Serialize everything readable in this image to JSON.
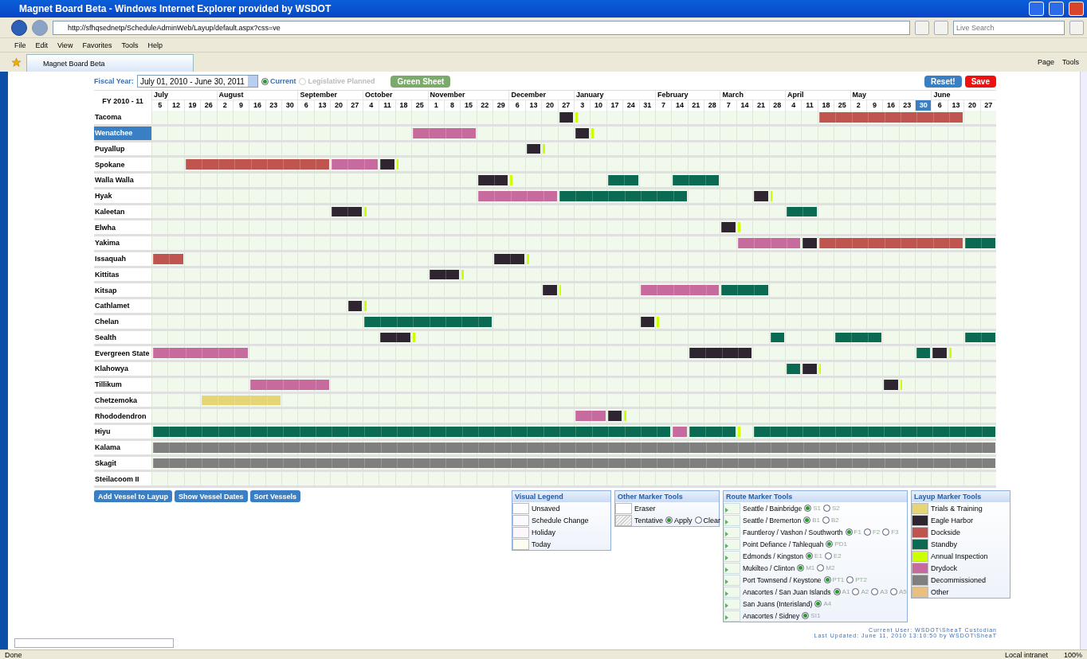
{
  "window": {
    "title": "Magnet Board Beta - Windows Internet Explorer provided by WSDOT"
  },
  "address_bar": {
    "url": "http://sfhqsednetp/ScheduleAdminWeb/Layup/default.aspx?css=ve"
  },
  "search": {
    "placeholder": "Live Search"
  },
  "menu": [
    "File",
    "Edit",
    "View",
    "Favorites",
    "Tools",
    "Help"
  ],
  "tabs": [
    {
      "label": "Magnet Board Beta",
      "selected": true
    }
  ],
  "command_bar": [
    "Page",
    "Tools"
  ],
  "fiscal_year": {
    "label": "Fiscal Year:",
    "value": "July 01, 2010 - June 30, 2011",
    "options": [
      {
        "label": "Current",
        "selected": true,
        "disabled": false
      },
      {
        "label": "Legislative Planned",
        "selected": false,
        "disabled": true
      }
    ],
    "green_sheet": "Green Sheet"
  },
  "actions": [
    "Reset!",
    "Save"
  ],
  "grid": {
    "corner": "FY 2010 - 11",
    "months": [
      {
        "label": "July",
        "days": [
          {
            "label": "5",
            "selected": false
          },
          {
            "label": "12",
            "selected": false
          },
          {
            "label": "19",
            "selected": false
          },
          {
            "label": "26",
            "selected": false
          }
        ]
      },
      {
        "label": "August",
        "days": [
          {
            "label": "2",
            "selected": false
          },
          {
            "label": "9",
            "selected": false
          },
          {
            "label": "16",
            "selected": false
          },
          {
            "label": "23",
            "selected": false
          },
          {
            "label": "30",
            "selected": false
          }
        ]
      },
      {
        "label": "September",
        "days": [
          {
            "label": "6",
            "selected": false
          },
          {
            "label": "13",
            "selected": false
          },
          {
            "label": "20",
            "selected": false
          },
          {
            "label": "27",
            "selected": false
          }
        ]
      },
      {
        "label": "October",
        "days": [
          {
            "label": "4",
            "selected": false
          },
          {
            "label": "11",
            "selected": false
          },
          {
            "label": "18",
            "selected": false
          },
          {
            "label": "25",
            "selected": false
          }
        ]
      },
      {
        "label": "November",
        "days": [
          {
            "label": "1",
            "selected": false
          },
          {
            "label": "8",
            "selected": false
          },
          {
            "label": "15",
            "selected": false
          },
          {
            "label": "22",
            "selected": false
          },
          {
            "label": "29",
            "selected": false
          }
        ]
      },
      {
        "label": "December",
        "days": [
          {
            "label": "6",
            "selected": false
          },
          {
            "label": "13",
            "selected": false
          },
          {
            "label": "20",
            "selected": false
          },
          {
            "label": "27",
            "selected": false
          }
        ]
      },
      {
        "label": "January",
        "days": [
          {
            "label": "3",
            "selected": false
          },
          {
            "label": "10",
            "selected": false
          },
          {
            "label": "17",
            "selected": false
          },
          {
            "label": "24",
            "selected": false
          },
          {
            "label": "31",
            "selected": false
          }
        ]
      },
      {
        "label": "February",
        "days": [
          {
            "label": "7",
            "selected": false
          },
          {
            "label": "14",
            "selected": false
          },
          {
            "label": "21",
            "selected": false
          },
          {
            "label": "28",
            "selected": false
          }
        ]
      },
      {
        "label": "March",
        "days": [
          {
            "label": "7",
            "selected": false
          },
          {
            "label": "14",
            "selected": false
          },
          {
            "label": "21",
            "selected": false
          },
          {
            "label": "28",
            "selected": false
          }
        ]
      },
      {
        "label": "April",
        "days": [
          {
            "label": "4",
            "selected": false
          },
          {
            "label": "11",
            "selected": false
          },
          {
            "label": "18",
            "selected": false
          },
          {
            "label": "25",
            "selected": false
          }
        ]
      },
      {
        "label": "May",
        "days": [
          {
            "label": "2",
            "selected": false
          },
          {
            "label": "9",
            "selected": false
          },
          {
            "label": "16",
            "selected": false
          },
          {
            "label": "23",
            "selected": false
          },
          {
            "label": "30",
            "selected": true
          }
        ]
      },
      {
        "label": "June",
        "days": [
          {
            "label": "6",
            "selected": false
          },
          {
            "label": "13",
            "selected": false
          },
          {
            "label": "20",
            "selected": false
          },
          {
            "label": "27",
            "selected": false
          }
        ]
      }
    ],
    "vessels": [
      {
        "name": "Tacoma",
        "selected": false,
        "segments": [
          {
            "color": "#2f2530"
          },
          {
            "color": "#ccff00"
          },
          {
            "color": "#c0554f"
          }
        ]
      },
      {
        "name": "Wenatchee",
        "selected": true,
        "segments": [
          {
            "color": "#c76a9e"
          },
          {
            "color": "#2f2530"
          },
          {
            "color": "#ccff00"
          }
        ]
      },
      {
        "name": "Puyallup",
        "selected": false,
        "segments": [
          {
            "color": "#2f2530"
          },
          {
            "color": "#ccff00"
          }
        ]
      },
      {
        "name": "Spokane",
        "selected": false,
        "segments": [
          {
            "color": "#c0554f"
          },
          {
            "color": "#c76a9e"
          },
          {
            "color": "#2f2530"
          },
          {
            "color": "#ccff00"
          }
        ]
      },
      {
        "name": "Walla Walla",
        "selected": false,
        "segments": [
          {
            "color": "#2f2530"
          },
          {
            "color": "#ccff00"
          },
          {
            "color": "#0b6b52"
          },
          {
            "color": "#0b6b52"
          }
        ]
      },
      {
        "name": "Hyak",
        "selected": false,
        "segments": [
          {
            "color": "#c76a9e"
          },
          {
            "color": "#0b6b52"
          },
          {
            "color": "#2f2530"
          },
          {
            "color": "#ccff00"
          }
        ]
      },
      {
        "name": "Kaleetan",
        "selected": false,
        "segments": [
          {
            "color": "#2f2530"
          },
          {
            "color": "#ccff00"
          },
          {
            "color": "#0b6b52"
          }
        ]
      },
      {
        "name": "Elwha",
        "selected": false,
        "segments": [
          {
            "color": "#2f2530"
          },
          {
            "color": "#ccff00"
          }
        ]
      },
      {
        "name": "Yakima",
        "selected": false,
        "segments": [
          {
            "color": "#c76a9e"
          },
          {
            "color": "#2f2530"
          },
          {
            "color": "#c0554f"
          },
          {
            "color": "#0b6b52"
          }
        ]
      },
      {
        "name": "Issaquah",
        "selected": false,
        "segments": [
          {
            "color": "#c0554f"
          },
          {
            "color": "#2f2530"
          },
          {
            "color": "#ccff00"
          }
        ]
      },
      {
        "name": "Kittitas",
        "selected": false,
        "segments": [
          {
            "color": "#2f2530"
          },
          {
            "color": "#ccff00"
          }
        ]
      },
      {
        "name": "Kitsap",
        "selected": false,
        "segments": [
          {
            "color": "#2f2530"
          },
          {
            "color": "#ccff00"
          },
          {
            "color": "#c76a9e"
          },
          {
            "color": "#0b6b52"
          }
        ]
      },
      {
        "name": "Cathlamet",
        "selected": false,
        "segments": [
          {
            "color": "#2f2530"
          },
          {
            "color": "#ccff00"
          }
        ]
      },
      {
        "name": "Chelan",
        "selected": false,
        "segments": [
          {
            "color": "#0b6b52"
          },
          {
            "color": "#2f2530"
          },
          {
            "color": "#ccff00"
          }
        ]
      },
      {
        "name": "Sealth",
        "selected": false,
        "segments": [
          {
            "color": "#2f2530"
          },
          {
            "color": "#ccff00"
          },
          {
            "color": "#0b6b52"
          },
          {
            "color": "#0b6b52"
          },
          {
            "color": "#0b6b52"
          }
        ]
      },
      {
        "name": "Evergreen State",
        "selected": false,
        "segments": [
          {
            "color": "#c76a9e"
          },
          {
            "color": "#2f2530"
          },
          {
            "color": "#0b6b52"
          },
          {
            "color": "#2f2530"
          },
          {
            "color": "#ccff00"
          }
        ]
      },
      {
        "name": "Klahowya",
        "selected": false,
        "segments": [
          {
            "color": "#0b6b52"
          },
          {
            "color": "#2f2530"
          },
          {
            "color": "#ccff00"
          }
        ]
      },
      {
        "name": "Tillikum",
        "selected": false,
        "segments": [
          {
            "color": "#c76a9e"
          },
          {
            "color": "#2f2530"
          },
          {
            "color": "#ccff00"
          }
        ]
      },
      {
        "name": "Chetzemoka",
        "selected": false,
        "segments": [
          {
            "color": "#e6d574"
          }
        ]
      },
      {
        "name": "Rhododendron",
        "selected": false,
        "segments": [
          {
            "color": "#c76a9e"
          },
          {
            "color": "#2f2530"
          },
          {
            "color": "#ccff00"
          }
        ]
      },
      {
        "name": "Hiyu",
        "selected": false,
        "segments": [
          {
            "color": "#0b6b52"
          },
          {
            "color": "#c76a9e"
          },
          {
            "color": "#0b6b52"
          },
          {
            "color": "#ccff00"
          },
          {
            "color": "#0b6b52"
          }
        ]
      },
      {
        "name": "Kalama",
        "selected": false,
        "segments": [
          {
            "color": "#7f7f7f"
          }
        ]
      },
      {
        "name": "Skagit",
        "selected": false,
        "segments": [
          {
            "color": "#7f7f7f"
          }
        ]
      },
      {
        "name": "Steilacoom II",
        "selected": false
      }
    ]
  },
  "buttons": [
    "Add Vessel to Layup",
    "Show Vessel Dates",
    "Sort Vessels"
  ],
  "visual_legend": {
    "title": "Visual Legend",
    "items": [
      "Unsaved",
      "Schedule Change",
      "Holiday",
      "Today"
    ]
  },
  "other_marker_tools": {
    "title": "Other Marker Tools",
    "eraser": "Eraser",
    "tentative": "Tentative",
    "options": [
      {
        "label": "Apply",
        "selected": true
      },
      {
        "label": "Clear",
        "selected": false
      }
    ]
  },
  "route_marker_tools": {
    "title": "Route Marker Tools",
    "routes": [
      {
        "name": "Seattle / Bainbridge",
        "options": [
          {
            "label": "S1",
            "selected": true
          },
          {
            "label": "S2",
            "selected": false
          }
        ]
      },
      {
        "name": "Seattle / Bremerton",
        "options": [
          {
            "label": "B1",
            "selected": true
          },
          {
            "label": "B2",
            "selected": false
          }
        ]
      },
      {
        "name": "Fauntleroy / Vashon / Southworth",
        "options": [
          {
            "label": "F1",
            "selected": true
          },
          {
            "label": "F2",
            "selected": false
          },
          {
            "label": "F3",
            "selected": false
          }
        ]
      },
      {
        "name": "Point Defiance / Tahlequah",
        "options": [
          {
            "label": "PD1",
            "selected": true
          }
        ]
      },
      {
        "name": "Edmonds / Kingston",
        "options": [
          {
            "label": "E1",
            "selected": true
          },
          {
            "label": "E2",
            "selected": false
          }
        ]
      },
      {
        "name": "Mukilteo / Clinton",
        "options": [
          {
            "label": "M1",
            "selected": true
          },
          {
            "label": "M2",
            "selected": false
          }
        ]
      },
      {
        "name": "Port Townsend / Keystone",
        "options": [
          {
            "label": "PT1",
            "selected": true
          },
          {
            "label": "PT2",
            "selected": false
          }
        ]
      },
      {
        "name": "Anacortes / San Juan Islands",
        "options": [
          {
            "label": "A1",
            "selected": true
          },
          {
            "label": "A2",
            "selected": false
          },
          {
            "label": "A3",
            "selected": false
          },
          {
            "label": "A5",
            "selected": false
          }
        ]
      },
      {
        "name": "San Juans (Interisland)",
        "options": [
          {
            "label": "A4",
            "selected": true
          }
        ]
      },
      {
        "name": "Anacortes / Sidney",
        "options": [
          {
            "label": "SI1",
            "selected": true
          }
        ]
      }
    ]
  },
  "layup_marker_tools": {
    "title": "Layup Marker Tools",
    "items": [
      {
        "label": "Trials & Training",
        "color": "#e6d574"
      },
      {
        "label": "Eagle Harbor",
        "color": "#2f2530"
      },
      {
        "label": "Dockside",
        "color": "#c0554f"
      },
      {
        "label": "Standby",
        "color": "#0b6b52"
      },
      {
        "label": "Annual Inspection",
        "color": "#ccff00"
      },
      {
        "label": "Drydock",
        "color": "#c76a9e"
      },
      {
        "label": "Decommissioned",
        "color": "#7f7f7f"
      },
      {
        "label": "Other",
        "color": "#e8bf80"
      }
    ]
  },
  "footer": {
    "current_user": "Current User: WSDOT\\SheaT Custodian",
    "last_updated": "Last Updated: June 11, 2010 13:10:50 by WSDOT\\SheaT"
  },
  "status_bar": {
    "status": "Done",
    "zone": "Local intranet",
    "zoom": "100%"
  }
}
